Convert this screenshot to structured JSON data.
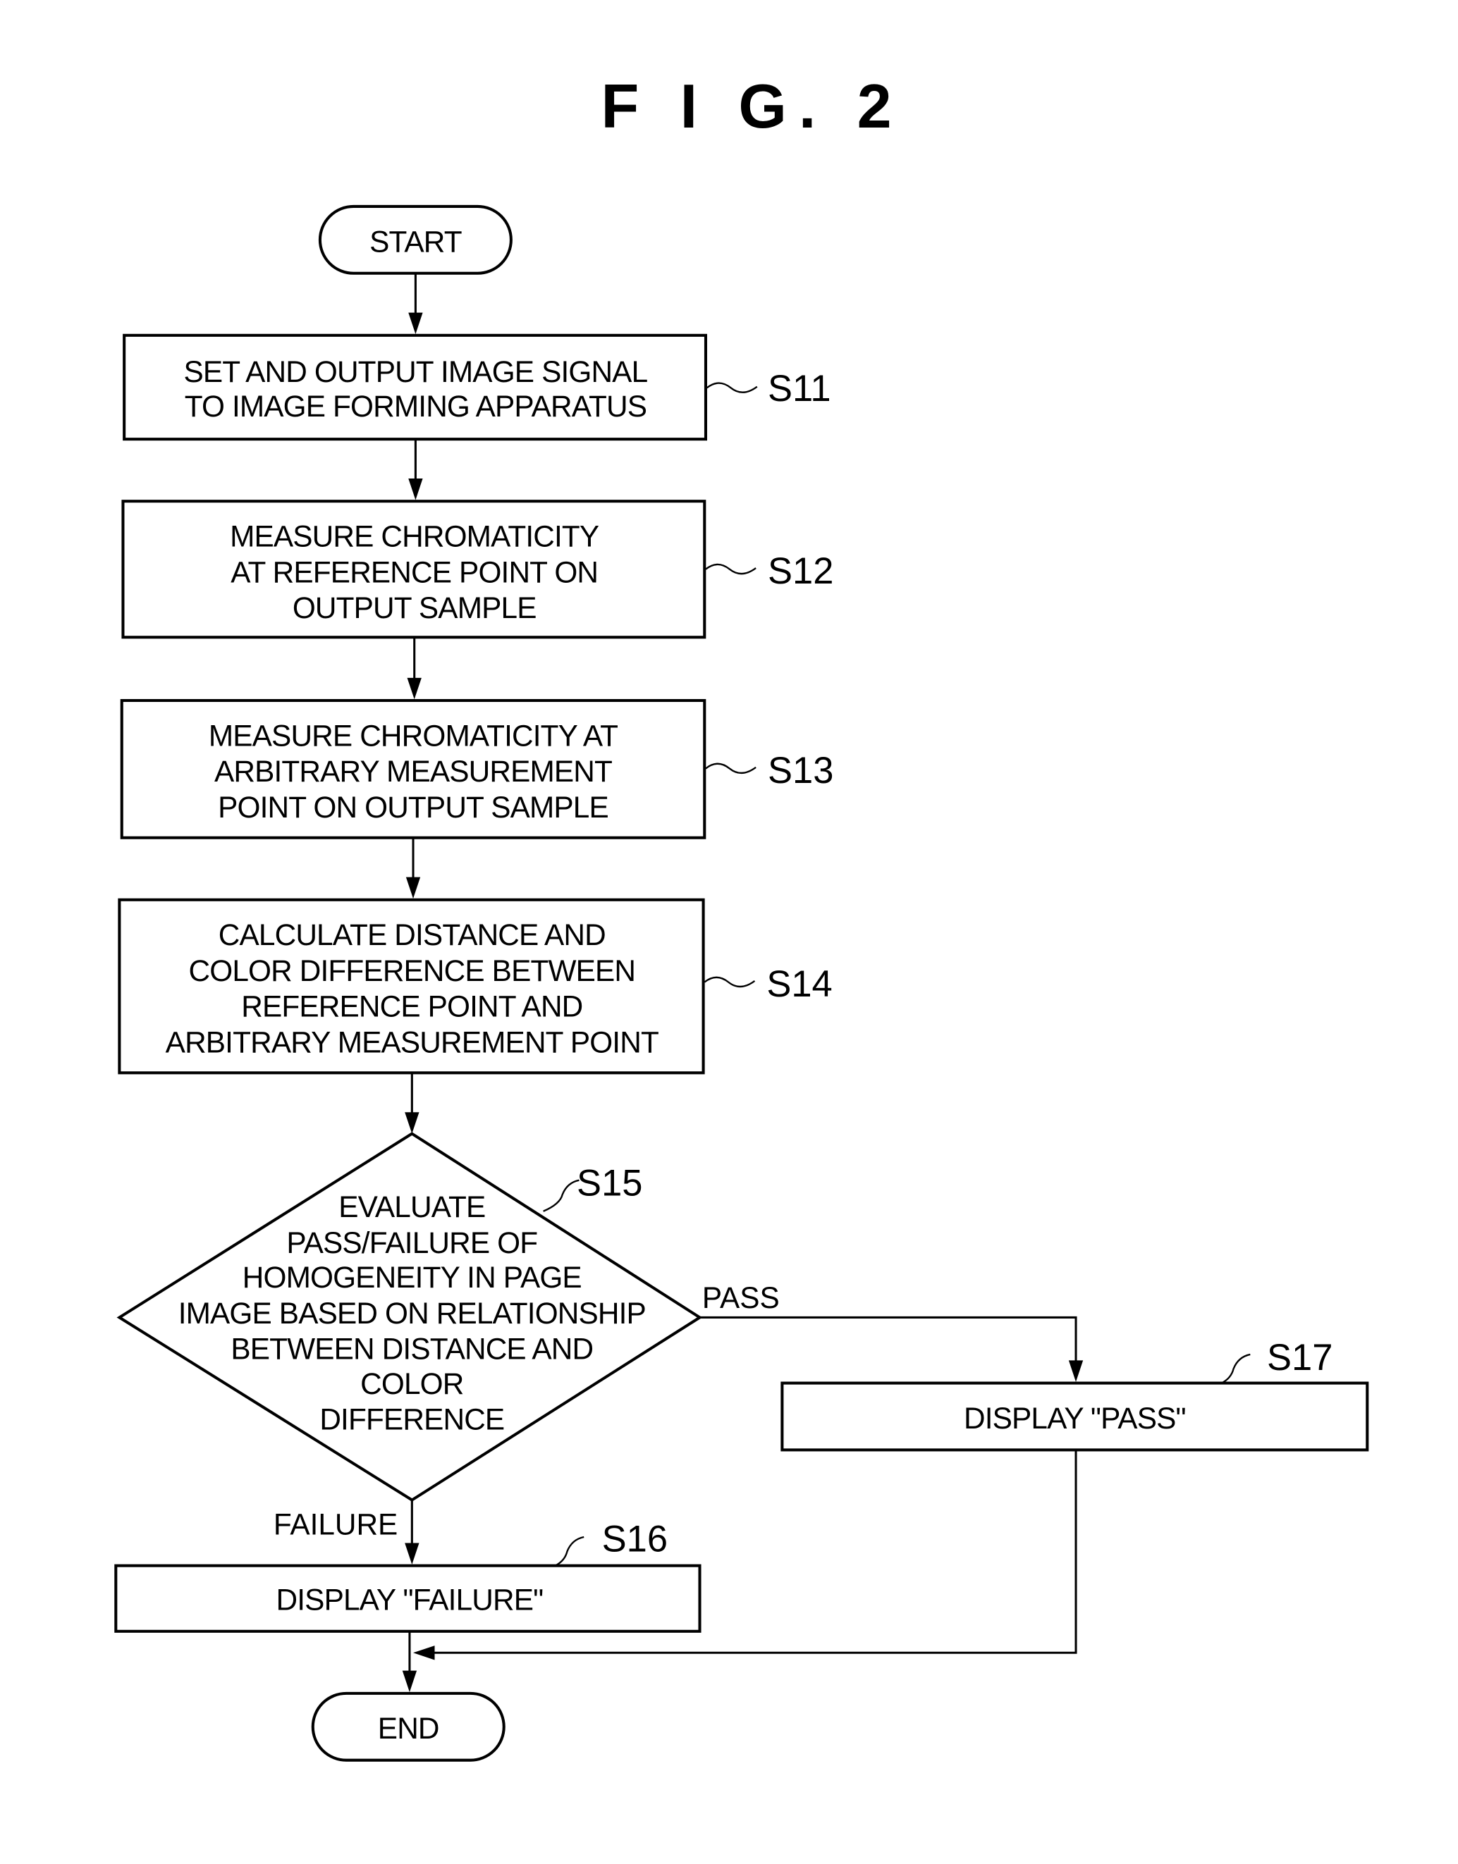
{
  "figure": {
    "title": "F I G. 2"
  },
  "flowchart": {
    "start": {
      "label": "START"
    },
    "end": {
      "label": "END"
    },
    "steps": [
      {
        "id": "S11",
        "lines": [
          "SET AND OUTPUT IMAGE SIGNAL",
          "TO IMAGE FORMING APPARATUS"
        ]
      },
      {
        "id": "S12",
        "lines": [
          "MEASURE CHROMATICITY",
          "AT REFERENCE POINT ON",
          "OUTPUT SAMPLE"
        ]
      },
      {
        "id": "S13",
        "lines": [
          "MEASURE CHROMATICITY AT",
          "ARBITRARY MEASUREMENT",
          "POINT ON OUTPUT SAMPLE"
        ]
      },
      {
        "id": "S14",
        "lines": [
          "CALCULATE DISTANCE AND",
          "COLOR DIFFERENCE BETWEEN",
          "REFERENCE POINT AND",
          "ARBITRARY MEASUREMENT POINT"
        ]
      }
    ],
    "decision": {
      "id": "S15",
      "lines": [
        "EVALUATE",
        "PASS/FAILURE OF",
        "HOMOGENEITY IN PAGE",
        "IMAGE BASED ON RELATIONSHIP",
        "BETWEEN DISTANCE AND",
        "COLOR",
        "DIFFERENCE"
      ],
      "pass_label": "PASS",
      "failure_label": "FAILURE"
    },
    "failure_step": {
      "id": "S16",
      "label": "DISPLAY \"FAILURE\""
    },
    "pass_step": {
      "id": "S17",
      "label": "DISPLAY \"PASS\""
    }
  }
}
